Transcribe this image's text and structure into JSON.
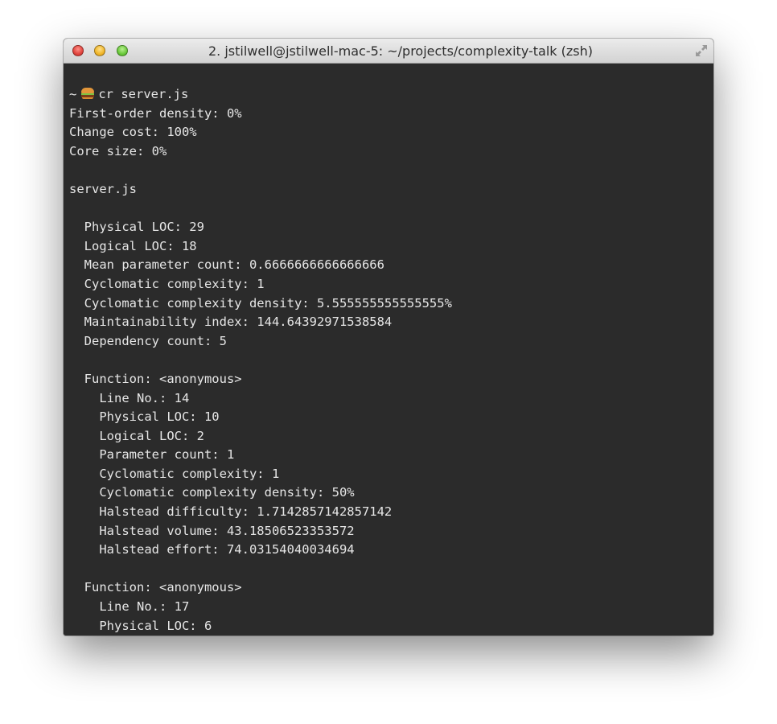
{
  "window": {
    "title": "2. jstilwell@jstilwell-mac-5: ~/projects/complexity-talk (zsh)"
  },
  "prompt": {
    "prefix": "~",
    "icon": "hamburger-emoji",
    "command": "cr server.js"
  },
  "lines": [
    "First-order density: 0%",
    "Change cost: 100%",
    "Core size: 0%",
    "",
    "server.js",
    "",
    "  Physical LOC: 29",
    "  Logical LOC: 18",
    "  Mean parameter count: 0.6666666666666666",
    "  Cyclomatic complexity: 1",
    "  Cyclomatic complexity density: 5.555555555555555%",
    "  Maintainability index: 144.64392971538584",
    "  Dependency count: 5",
    "",
    "  Function: <anonymous>",
    "    Line No.: 14",
    "    Physical LOC: 10",
    "    Logical LOC: 2",
    "    Parameter count: 1",
    "    Cyclomatic complexity: 1",
    "    Cyclomatic complexity density: 50%",
    "    Halstead difficulty: 1.7142857142857142",
    "    Halstead volume: 43.18506523353572",
    "    Halstead effort: 74.03154040034694",
    "",
    "  Function: <anonymous>",
    "    Line No.: 17",
    "    Physical LOC: 6"
  ]
}
